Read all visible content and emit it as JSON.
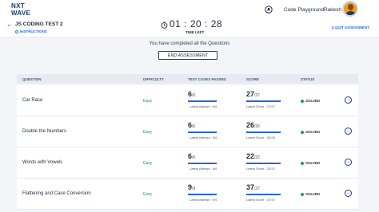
{
  "header": {
    "logo_line1": "NXT",
    "logo_line2": "WAVE",
    "code_playground": "Code Playground",
    "username": "Rakesh"
  },
  "subheader": {
    "test_title": "JS CODING TEST 2",
    "instructions": "INSTRUCTIONS",
    "timer": "01 : 20 : 28",
    "time_left": "TIME LEFT",
    "quit": "QUIT ASSESSMENT"
  },
  "main": {
    "completed_message": "You have completed all the Questions",
    "end_button": "END ASSESSMENT"
  },
  "table": {
    "columns": [
      "QUESTION",
      "DIFFICULTY",
      "TEST CASES PASSED",
      "SCORE",
      "STATUS"
    ],
    "rows": [
      {
        "question": "Car Race",
        "difficulty": "Easy",
        "passed": "6",
        "total_cases": "/6",
        "latest_attempt": "Latest Attempt : 6/6",
        "score": "27",
        "max_score": "/27",
        "latest_score": "Latest Score : 27/27",
        "status": "SOLVED",
        "progress": 1.0
      },
      {
        "question": "Double the Numbers",
        "difficulty": "Easy",
        "passed": "6",
        "total_cases": "/6",
        "latest_attempt": "Latest Attempt : 6/6",
        "score": "26",
        "max_score": "/26",
        "latest_score": "Latest Score : 26/26",
        "status": "SOLVED",
        "progress": 1.0
      },
      {
        "question": "Words with Vowels",
        "difficulty": "Easy",
        "passed": "6",
        "total_cases": "/6",
        "latest_attempt": "Latest Attempt : 6/6",
        "score": "22",
        "max_score": "/22",
        "latest_score": "Latest Score : 22/22",
        "status": "SOLVED",
        "progress": 1.0
      },
      {
        "question": "Flattening and Case Conversion",
        "difficulty": "Easy",
        "passed": "9",
        "total_cases": "/9",
        "latest_attempt": "Latest Attempt : 9/9",
        "score": "37",
        "max_score": "/37",
        "latest_score": "Latest Score : 37/37",
        "status": "SOLVED",
        "progress": 1.0
      }
    ]
  },
  "colors": {
    "accent": "#2563eb",
    "solved": "#16a34a",
    "easy": "#16a34a"
  },
  "icons": {
    "notification": "bell-icon",
    "back": "back-arrow-icon",
    "timer": "clock-icon",
    "go": "arrow-right-circle-icon"
  }
}
